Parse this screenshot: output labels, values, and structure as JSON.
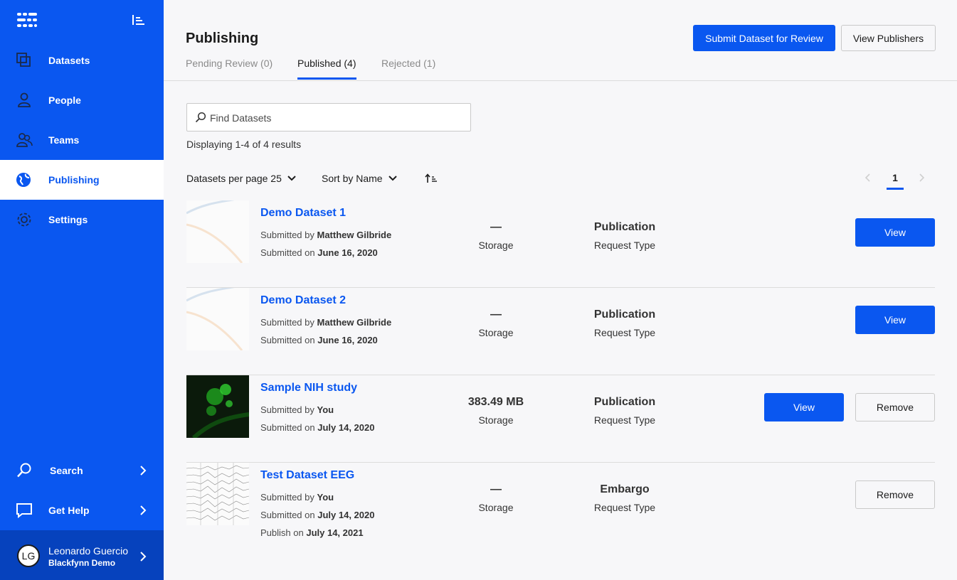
{
  "sidebar": {
    "items": [
      {
        "label": "Datasets",
        "icon": "datasets-icon"
      },
      {
        "label": "People",
        "icon": "person-icon"
      },
      {
        "label": "Teams",
        "icon": "teams-icon"
      },
      {
        "label": "Publishing",
        "icon": "globe-icon"
      },
      {
        "label": "Settings",
        "icon": "gear-icon"
      }
    ],
    "active": "Publishing",
    "bottom": [
      {
        "label": "Search",
        "icon": "search-icon"
      },
      {
        "label": "Get Help",
        "icon": "chat-icon"
      }
    ],
    "user": {
      "initials": "LG",
      "name": "Leonardo Guercio",
      "org": "Blackfynn Demo"
    }
  },
  "header": {
    "title": "Publishing",
    "tabs": [
      {
        "label": "Pending Review (0)"
      },
      {
        "label": "Published (4)"
      },
      {
        "label": "Rejected (1)"
      }
    ],
    "active_tab": "Published (4)",
    "submit_label": "Submit Dataset for Review",
    "publishers_label": "View Publishers"
  },
  "search": {
    "placeholder": "Find Datasets"
  },
  "results_text": "Displaying 1-4 of 4 results",
  "controls": {
    "per_page_label": "Datasets per page 25",
    "sort_label": "Sort by Name"
  },
  "pager": {
    "current": "1"
  },
  "datasets": [
    {
      "title": "Demo Dataset 1",
      "submitted_by_label": "Submitted by",
      "submitted_by": "Matthew Gilbride",
      "submitted_on_label": "Submitted on",
      "submitted_on": "June 16, 2020",
      "storage": "—",
      "storage_label": "Storage",
      "request_type": "Publication",
      "request_type_label": "Request Type",
      "view_label": "View"
    },
    {
      "title": "Demo Dataset 2",
      "submitted_by_label": "Submitted by",
      "submitted_by": "Matthew Gilbride",
      "submitted_on_label": "Submitted on",
      "submitted_on": "June 16, 2020",
      "storage": "—",
      "storage_label": "Storage",
      "request_type": "Publication",
      "request_type_label": "Request Type",
      "view_label": "View"
    },
    {
      "title": "Sample NIH study",
      "submitted_by_label": "Submitted by",
      "submitted_by": "You",
      "submitted_on_label": "Submitted on",
      "submitted_on": "July 14, 2020",
      "storage": "383.49 MB",
      "storage_label": "Storage",
      "request_type": "Publication",
      "request_type_label": "Request Type",
      "view_label": "View",
      "remove_label": "Remove"
    },
    {
      "title": "Test Dataset EEG",
      "submitted_by_label": "Submitted by",
      "submitted_by": "You",
      "submitted_on_label": "Submitted on",
      "submitted_on": "July 14, 2020",
      "publish_on_label": "Publish on",
      "publish_on": "July 14, 2021",
      "storage": "—",
      "storage_label": "Storage",
      "request_type": "Embargo",
      "request_type_label": "Request Type",
      "remove_label": "Remove"
    }
  ],
  "colors": {
    "primary": "#0a57f0",
    "sidebar": "#0a57f0",
    "sidebar_user": "#0642bd"
  }
}
